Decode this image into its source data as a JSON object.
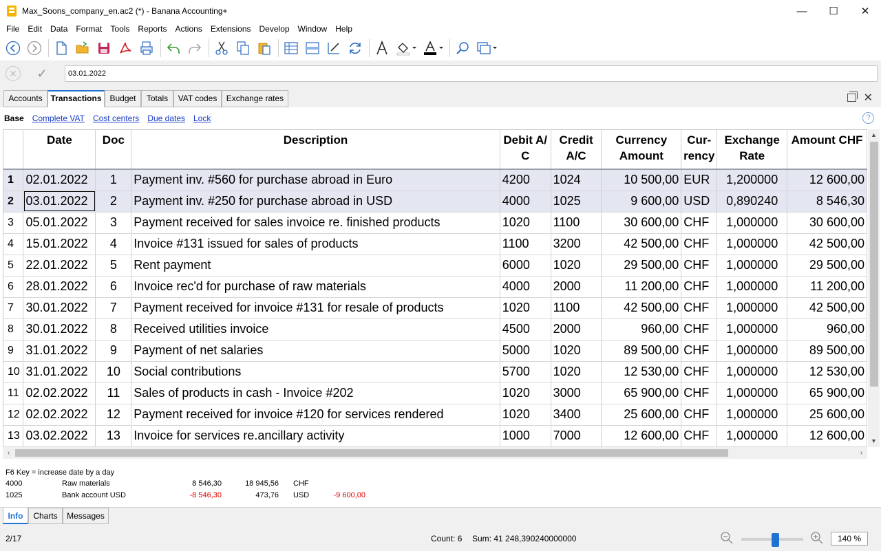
{
  "window": {
    "title": "Max_Soons_company_en.ac2 (*) - Banana Accounting+",
    "minimize": "—",
    "maximize": "☐",
    "close": "✕"
  },
  "menu": [
    "File",
    "Edit",
    "Data",
    "Format",
    "Tools",
    "Reports",
    "Actions",
    "Extensions",
    "Develop",
    "Window",
    "Help"
  ],
  "toolbar": {
    "icons": [
      "back-icon",
      "forward-icon",
      "new-file-icon",
      "open-folder-icon",
      "save-icon",
      "pdf-icon",
      "print-preview-icon",
      "undo-icon",
      "redo-icon",
      "cut-icon",
      "copy-icon",
      "paste-icon",
      "add-rows-icon",
      "insert-rows-icon",
      "edit-rows-icon",
      "recalculate-icon",
      "font-icon",
      "fill-color-icon",
      "text-color-icon",
      "search-icon",
      "window-icon"
    ]
  },
  "editbar": {
    "value": "03.01.2022"
  },
  "tabs": [
    "Accounts",
    "Transactions",
    "Budget",
    "Totals",
    "VAT codes",
    "Exchange rates"
  ],
  "active_tab": "Transactions",
  "views": [
    "Base",
    "Complete VAT",
    "Cost centers",
    "Due dates",
    "Lock"
  ],
  "table": {
    "headers": {
      "date": "Date",
      "doc": "Doc",
      "description": "Description",
      "debit_1": "Debit A/",
      "debit_2": "C",
      "credit_1": "Credit",
      "credit_2": "A/C",
      "curamount_1": "Currency",
      "curamount_2": "Amount",
      "currency_1": "Cur-",
      "currency_2": "rency",
      "rate_1": "Exchange",
      "rate_2": "Rate",
      "amount": "Amount CHF"
    },
    "rows": [
      [
        "1",
        "02.01.2022",
        "1",
        "Payment inv. #560 for purchase abroad in Euro",
        "4200",
        "1024",
        "10 500,00",
        "EUR",
        "1,200000",
        "12 600,00"
      ],
      [
        "2",
        "03.01.2022",
        "2",
        "Payment inv. #250 for purchase abroad in USD",
        "4000",
        "1025",
        "9 600,00",
        "USD",
        "0,890240",
        "8 546,30"
      ],
      [
        "3",
        "05.01.2022",
        "3",
        "Payment received for sales invoice re. finished products",
        "1020",
        "1100",
        "30 600,00",
        "CHF",
        "1,000000",
        "30 600,00"
      ],
      [
        "4",
        "15.01.2022",
        "4",
        "Invoice #131 issued for sales of products",
        "1100",
        "3200",
        "42 500,00",
        "CHF",
        "1,000000",
        "42 500,00"
      ],
      [
        "5",
        "22.01.2022",
        "5",
        "Rent payment",
        "6000",
        "1020",
        "29 500,00",
        "CHF",
        "1,000000",
        "29 500,00"
      ],
      [
        "6",
        "28.01.2022",
        "6",
        "Invoice rec'd for purchase of raw materials",
        "4000",
        "2000",
        "11 200,00",
        "CHF",
        "1,000000",
        "11 200,00"
      ],
      [
        "7",
        "30.01.2022",
        "7",
        "Payment received for invoice #131 for resale of products",
        "1020",
        "1100",
        "42 500,00",
        "CHF",
        "1,000000",
        "42 500,00"
      ],
      [
        "8",
        "30.01.2022",
        "8",
        "Received utilities invoice",
        "4500",
        "2000",
        "960,00",
        "CHF",
        "1,000000",
        "960,00"
      ],
      [
        "9",
        "31.01.2022",
        "9",
        "Payment of net salaries",
        "5000",
        "1020",
        "89 500,00",
        "CHF",
        "1,000000",
        "89 500,00"
      ],
      [
        "10",
        "31.01.2022",
        "10",
        "Social contributions",
        "5700",
        "1020",
        "12 530,00",
        "CHF",
        "1,000000",
        "12 530,00"
      ],
      [
        "11",
        "02.02.2022",
        "11",
        "Sales of products in cash - Invoice #202",
        "1020",
        "3000",
        "65 900,00",
        "CHF",
        "1,000000",
        "65 900,00"
      ],
      [
        "12",
        "02.02.2022",
        "12",
        "Payment received for invoice #120 for services rendered",
        "1020",
        "3400",
        "25 600,00",
        "CHF",
        "1,000000",
        "25 600,00"
      ],
      [
        "13",
        "03.02.2022",
        "13",
        "Invoice for services re.ancillary activity",
        "1000",
        "7000",
        "12 600,00",
        "CHF",
        "1,000000",
        "12 600,00"
      ]
    ]
  },
  "info": {
    "hint": "F6 Key = increase date by a day",
    "lines": [
      {
        "account": "4000",
        "name": "Raw materials",
        "amount": "8 546,30",
        "balance": "18 945,56",
        "currency": "CHF",
        "cur_amount": ""
      },
      {
        "account": "1025",
        "name": "Bank account USD",
        "amount": "-8 546,30",
        "balance": "473,76",
        "currency": "USD",
        "cur_amount": "-9 600,00"
      }
    ]
  },
  "bottom_tabs": [
    "Info",
    "Charts",
    "Messages"
  ],
  "status": {
    "position": "2/17",
    "count": "Count: 6",
    "sum": "Sum: 41 248,390240000000",
    "zoom": "140 %"
  },
  "colors": {
    "accent": "#1e73d2",
    "selected_row": "#e4e6f2",
    "negative": "#e00000",
    "link": "#1a3cc8"
  }
}
